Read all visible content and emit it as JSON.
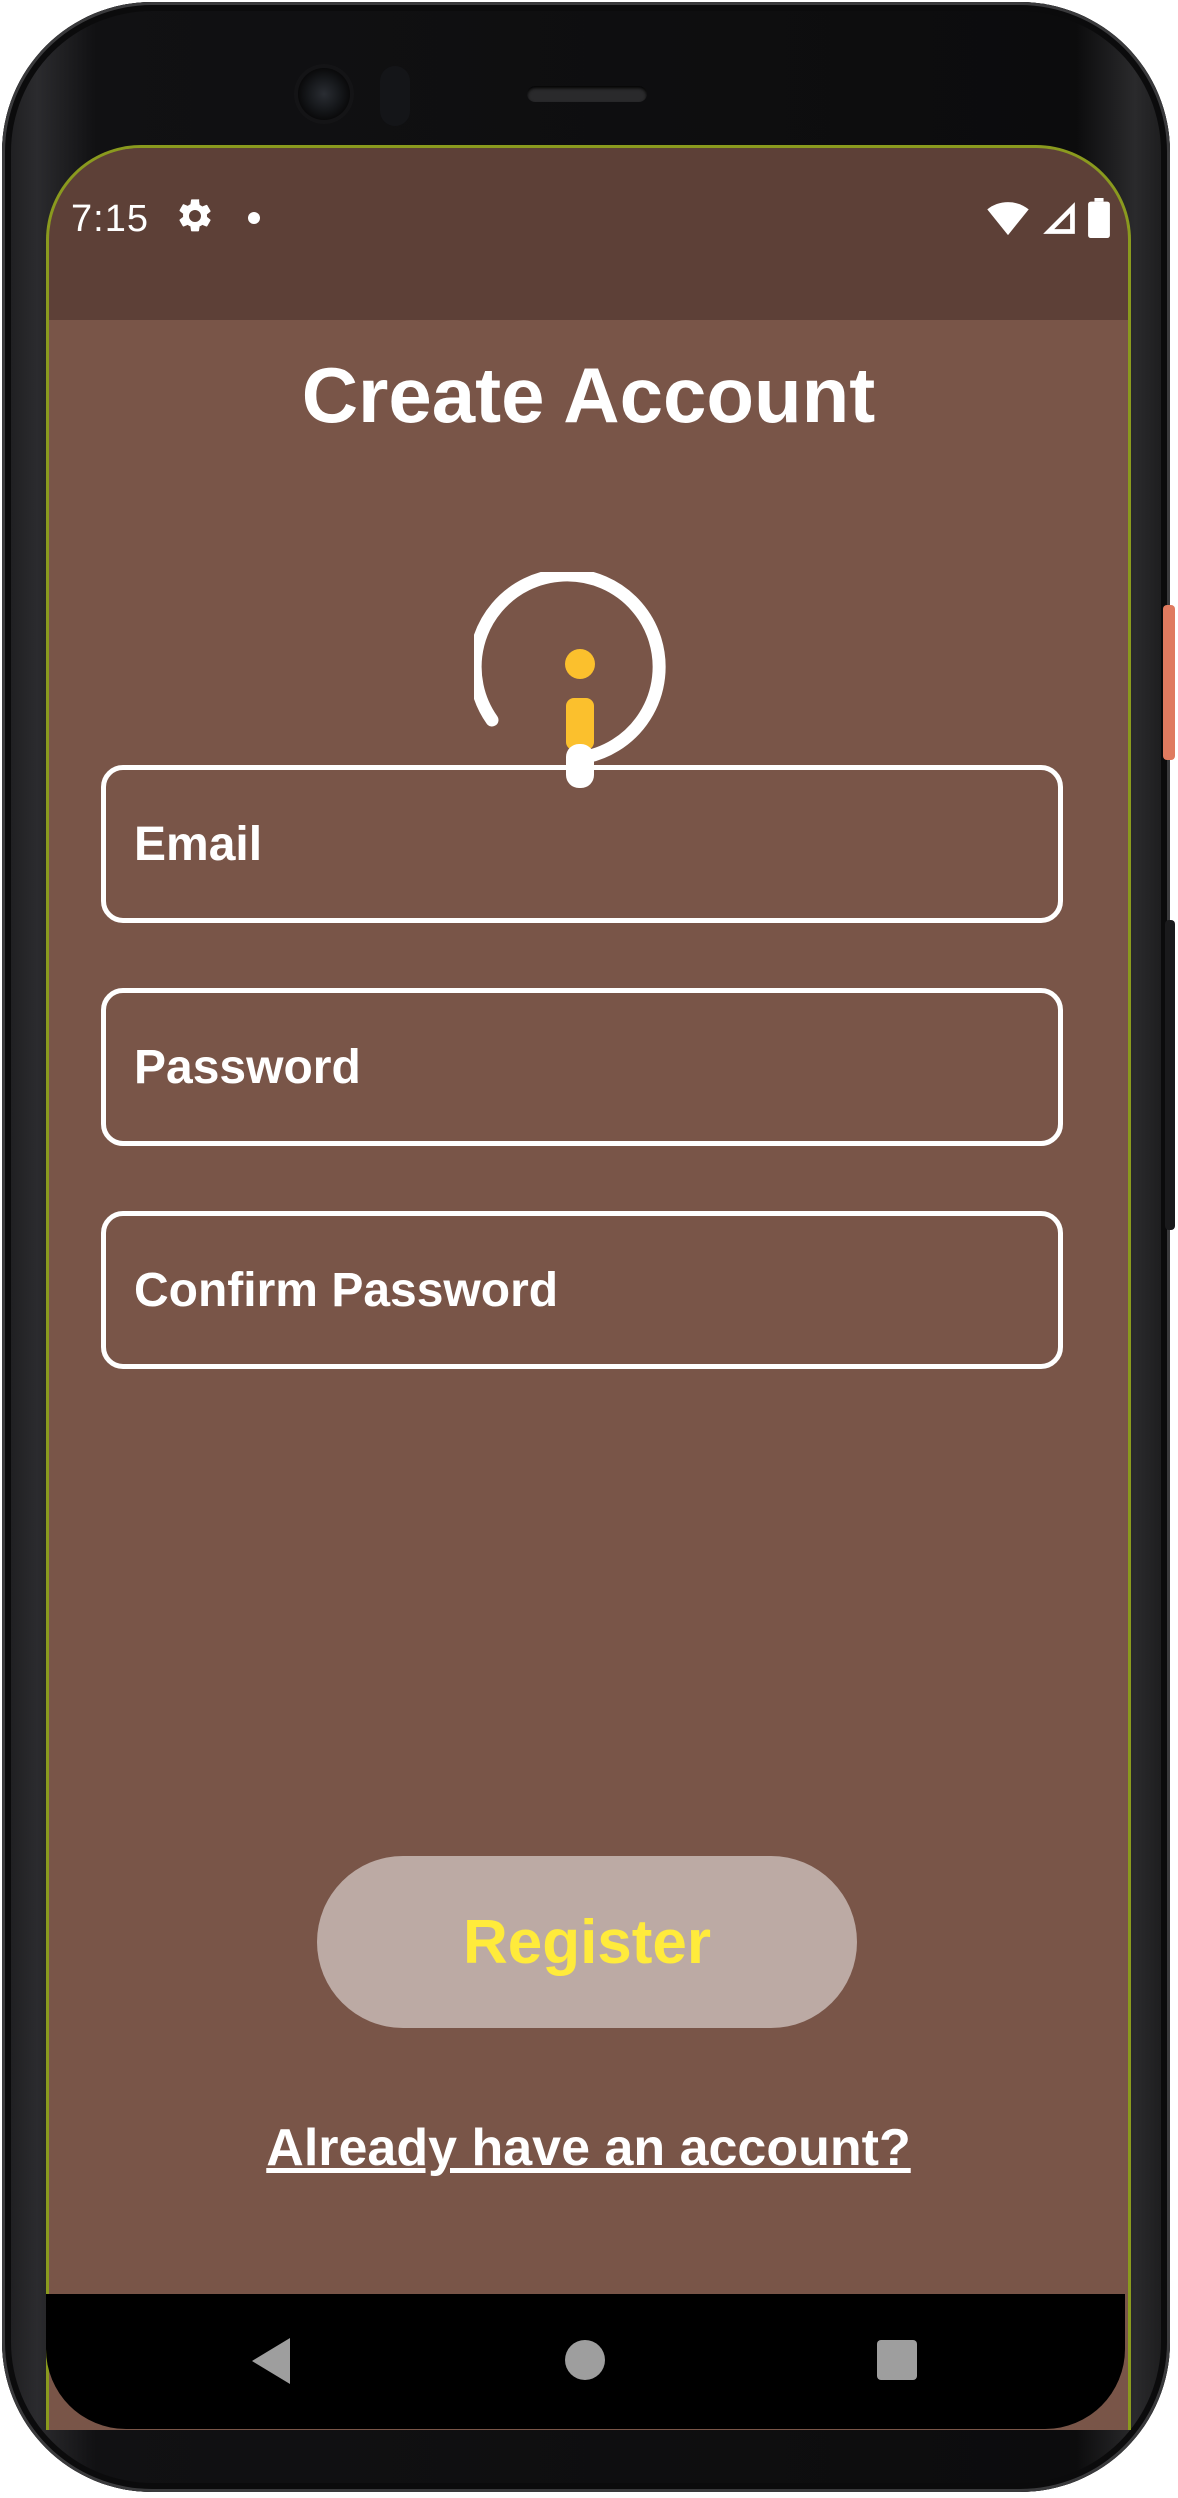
{
  "status_bar": {
    "time": "7:15",
    "icons": [
      "gear-icon",
      "notification-dot",
      "wifi-icon",
      "signal-icon",
      "battery-icon"
    ]
  },
  "page": {
    "title": "Create Account",
    "logo": "info-logo-icon"
  },
  "form": {
    "email_placeholder": "Email",
    "password_placeholder": "Password",
    "confirm_password_placeholder": "Confirm Password",
    "register_label": "Register",
    "login_link": "Already have an account?"
  },
  "navigation": {
    "items": [
      "back-icon",
      "home-icon",
      "recents-icon"
    ]
  },
  "colors": {
    "background": "#795548",
    "status_bar": "#5d4037",
    "button_bg": "#bcaaa4",
    "button_text": "#ffeb3b",
    "logo_accent": "#fbc02d"
  }
}
